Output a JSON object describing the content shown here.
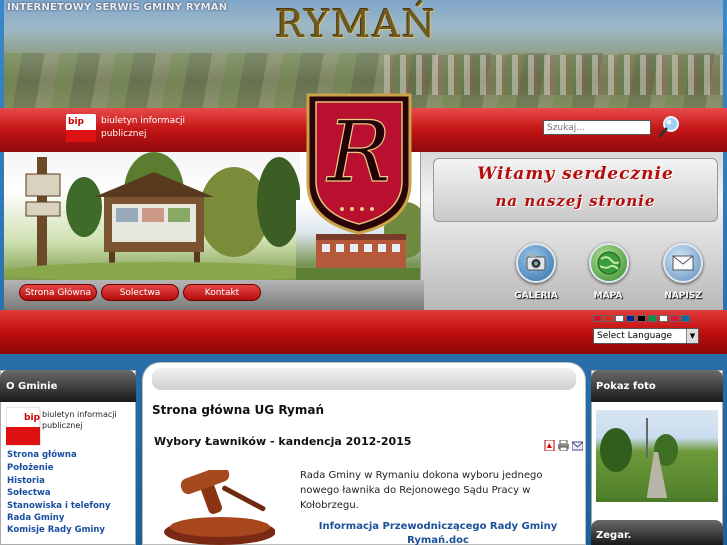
{
  "banner": {
    "tagline": "INTERNETOWY SERWIS GMINY RYMAŃ",
    "title": "RYMAŃ"
  },
  "header": {
    "bip_label": "biuletyn informacji publicznej",
    "search_placeholder": "Szukaj..."
  },
  "crest": {
    "letter": "R"
  },
  "welcome": {
    "line1": "Witamy serdecznie",
    "line2": "na naszej stronie"
  },
  "quick_buttons": [
    {
      "label": "GALERIA",
      "icon": "camera-icon"
    },
    {
      "label": "MAPA",
      "icon": "globe-icon"
    },
    {
      "label": "NAPISZ",
      "icon": "envelope-icon"
    }
  ],
  "nav": {
    "tabs": [
      {
        "label": "Strona Główna"
      },
      {
        "label": "Solectwa"
      },
      {
        "label": "Kontakt"
      }
    ]
  },
  "language": {
    "selected": "Select Language",
    "flag_colors": [
      "#cf142b",
      "#d52b1e",
      "#ffffff",
      "#002395",
      "#000000",
      "#009246",
      "#ffffff",
      "#dc143c",
      "#006aa7"
    ]
  },
  "left": {
    "title": "O Gminie",
    "bip_label": "biuletyn informacji publicznej",
    "links": [
      "Strona główna",
      "Położenie",
      "Historia",
      "Sołectwa",
      "Stanowiska i telefony",
      "Rada Gminy",
      "Komisje Rady Gminy"
    ]
  },
  "main": {
    "page_title": "Strona główna UG Rymań",
    "article_title": "Wybory Ławników - kandencja 2012-2015",
    "icons": [
      "pdf-icon",
      "print-icon",
      "email-icon"
    ],
    "paragraph": "Rada Gminy w Rymaniu dokona wyboru jednego nowego ławnika do  Rejonowego Sądu Pracy w Kołobrzegu.",
    "link": "Informacja Przewodniczącego Rady Gminy Rymań.doc"
  },
  "right": {
    "photo_title": "Pokaz foto",
    "clock_title": "Zegar."
  },
  "colors": {
    "brand_red": "#c21414",
    "link_blue": "#1a4fa0",
    "background_blue": "#2a6ea8"
  }
}
